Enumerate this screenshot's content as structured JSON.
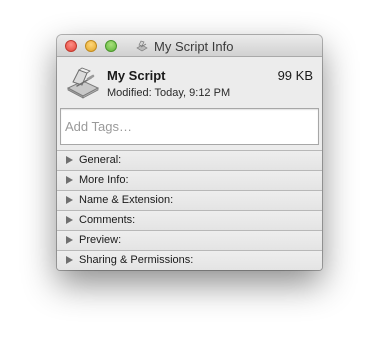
{
  "window": {
    "title": "My Script Info",
    "title_icon": "script-icon",
    "controls": [
      "close",
      "minimize",
      "zoom"
    ]
  },
  "file": {
    "icon": "applescript-script-icon",
    "name": "My Script",
    "size": "99 KB",
    "modified": "Modified: Today, 9:12 PM"
  },
  "tags": {
    "placeholder": "Add Tags…",
    "value": ""
  },
  "sections": [
    {
      "label": "General:"
    },
    {
      "label": "More Info:"
    },
    {
      "label": "Name & Extension:"
    },
    {
      "label": "Comments:"
    },
    {
      "label": "Preview:"
    },
    {
      "label": "Sharing & Permissions:"
    }
  ],
  "colors": {
    "close": "#e2463a",
    "minimize": "#e2a72a",
    "zoom": "#5fb53b"
  }
}
